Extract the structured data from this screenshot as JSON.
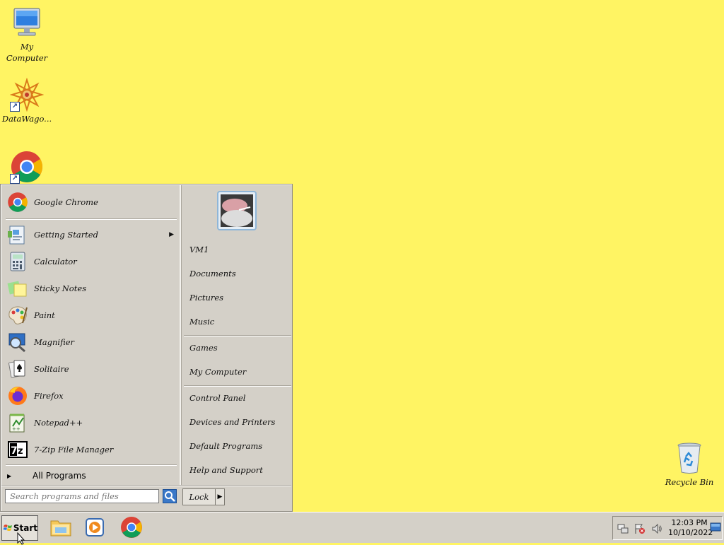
{
  "desktop": {
    "icons": [
      {
        "label": "My\nComputer"
      },
      {
        "label": "DataWago..."
      },
      {
        "label": ""
      },
      {
        "label": "Recycle Bin"
      }
    ]
  },
  "start_menu": {
    "pinned": {
      "label": "Google Chrome"
    },
    "recent": [
      {
        "label": "Getting Started",
        "has_submenu": true
      },
      {
        "label": "Calculator"
      },
      {
        "label": "Sticky Notes"
      },
      {
        "label": "Paint"
      },
      {
        "label": "Magnifier"
      },
      {
        "label": "Solitaire"
      },
      {
        "label": "Firefox"
      },
      {
        "label": "Notepad++"
      },
      {
        "label": "7-Zip File Manager"
      }
    ],
    "all_programs": "All Programs",
    "right": {
      "user": "VM1",
      "documents": "Documents",
      "pictures": "Pictures",
      "music": "Music",
      "games": "Games",
      "my_computer": "My Computer",
      "control_panel": "Control Panel",
      "devices": "Devices and Printers",
      "default_programs": "Default Programs",
      "help": "Help and Support"
    },
    "search_placeholder": "Search programs and files",
    "lock_label": "Lock"
  },
  "taskbar": {
    "start_label": "Start",
    "clock": {
      "time": "12:03 PM",
      "date": "10/10/2022"
    }
  },
  "colors": {
    "desktop": "#fff463",
    "menu": "#d4d0c8",
    "taskbar": "#d4d0c8"
  }
}
